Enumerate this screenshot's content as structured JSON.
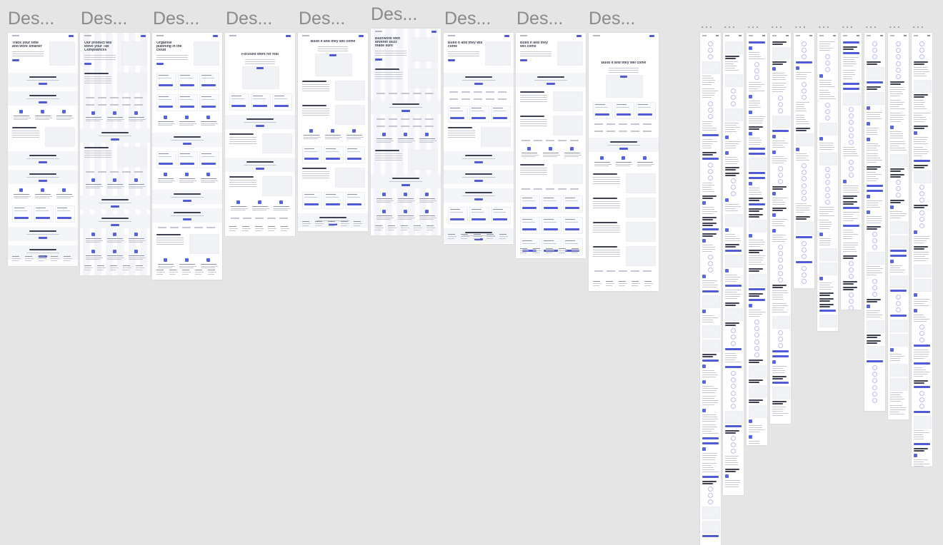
{
  "canvas": {
    "background": "#e5e5e5",
    "accent": "#4f5bd5",
    "frame_title_color": "#8a8a8a"
  },
  "desktop_frames": [
    {
      "title": "Des...",
      "hero": [
        "Track your time",
        "and work smarter"
      ]
    },
    {
      "title": "Des...",
      "hero": [
        "Our product will",
        "solve your Tax",
        "Compliances"
      ]
    },
    {
      "title": "Des...",
      "hero": [
        "Organise",
        "planning in the",
        "cloud"
      ]
    },
    {
      "title": "Des...",
      "hero": [
        "Focused work for real"
      ]
    },
    {
      "title": "Des...",
      "hero": [
        "Build it and they will come"
      ]
    },
    {
      "title": "Des...",
      "hero": [
        "Buzzword with",
        "another buzz",
        "made sure"
      ]
    },
    {
      "title": "Des...",
      "hero": [
        "Build it and they will",
        "come"
      ]
    },
    {
      "title": "Des...",
      "hero": [
        "Build it and they",
        "will come"
      ]
    },
    {
      "title": "Des...",
      "hero": [
        "Build it and they will come"
      ]
    }
  ],
  "mobile_frames": [
    {
      "title": "..."
    },
    {
      "title": "..."
    },
    {
      "title": "..."
    },
    {
      "title": "..."
    },
    {
      "title": "..."
    },
    {
      "title": "..."
    },
    {
      "title": "..."
    },
    {
      "title": "..."
    },
    {
      "title": "..."
    },
    {
      "title": "..."
    }
  ]
}
